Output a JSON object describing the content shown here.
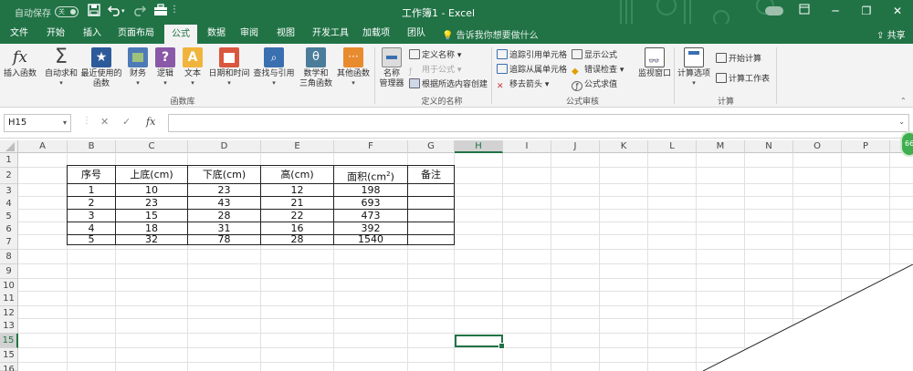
{
  "titlebar": {
    "autosave_label": "自动保存",
    "autosave_state": "关",
    "title": "工作簿1  -  Excel",
    "window_controls": [
      "restore-ribbon-icon",
      "minimize-icon",
      "maximize-icon",
      "close-icon"
    ]
  },
  "tabs": [
    "文件",
    "开始",
    "插入",
    "页面布局",
    "公式",
    "数据",
    "审阅",
    "视图",
    "开发工具",
    "加载项",
    "团队"
  ],
  "active_tab": "公式",
  "tell_me": "告诉我你想要做什么",
  "share_label": "共享",
  "ribbon": {
    "insert_function": "插入函数",
    "autosum": "自动求和",
    "recent_line1": "最近使用的",
    "recent_line2": "函数",
    "financial": "财务",
    "logical": "逻辑",
    "text": "文本",
    "datetime": "日期和时间",
    "lookup": "查找与引用",
    "math_line1": "数学和",
    "math_line2": "三角函数",
    "more": "其他函数",
    "library_group": "函数库",
    "name_manager_line1": "名称",
    "name_manager_line2": "管理器",
    "define_name": "定义名称",
    "use_in_formula": "用于公式",
    "create_from_selection": "根据所选内容创建",
    "names_group": "定义的名称",
    "trace_precedents": "追踪引用单元格",
    "trace_dependents": "追踪从属单元格",
    "remove_arrows": "移去箭头",
    "show_formulas": "显示公式",
    "error_checking": "错误检查",
    "evaluate_formula": "公式求值",
    "watch_window": "监视窗口",
    "auditing_group": "公式审核",
    "calc_options": "计算选项",
    "calc_now": "开始计算",
    "calc_sheet": "计算工作表",
    "calc_group": "计算"
  },
  "formula_bar": {
    "name_box": "H15",
    "cancel": "✕",
    "enter": "✓",
    "fx": "fx",
    "value": ""
  },
  "columns": [
    "A",
    "B",
    "C",
    "D",
    "E",
    "F",
    "G",
    "H",
    "I",
    "J",
    "K",
    "L",
    "M",
    "N",
    "O",
    "P"
  ],
  "selected_column": "H",
  "rows": [
    "1",
    "2",
    "3",
    "4",
    "5",
    "6",
    "7",
    "8",
    "9",
    "10",
    "11",
    "12",
    "13",
    "14",
    "15",
    "16"
  ],
  "selected_row": "15",
  "selected_cell": "H15",
  "table": {
    "headers": [
      "序号",
      "上底(cm)",
      "下底(cm)",
      "高(cm)",
      "面积(cm",
      "2",
      ")",
      "备注"
    ],
    "rows": [
      [
        "1",
        "10",
        "23",
        "12",
        "198",
        ""
      ],
      [
        "2",
        "23",
        "43",
        "21",
        "693",
        ""
      ],
      [
        "3",
        "15",
        "28",
        "22",
        "473",
        ""
      ],
      [
        "4",
        "18",
        "31",
        "16",
        "392",
        ""
      ],
      [
        "5",
        "32",
        "78",
        "28",
        "1540",
        ""
      ]
    ]
  },
  "side_badge": "66",
  "colors": {
    "excel_green": "#217346",
    "ribbon_bg": "#f3f3f3",
    "grid_line": "#e1e1e1"
  }
}
